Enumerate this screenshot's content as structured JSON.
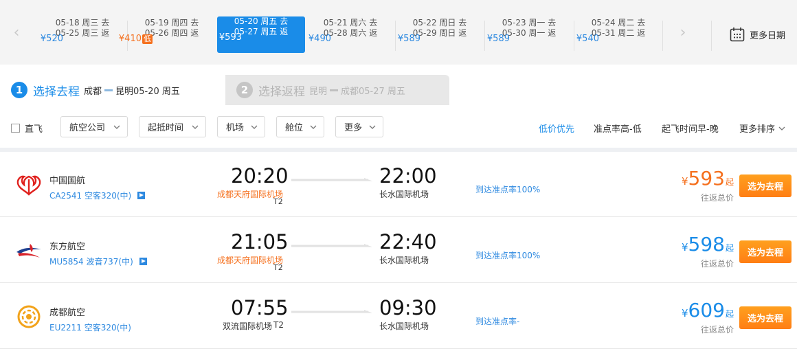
{
  "date_strip": {
    "cells": [
      {
        "go": "05-18  周三 去",
        "ret": "05-25  周三 返",
        "price": "¥520"
      },
      {
        "go": "05-19  周四 去",
        "ret": "05-26  周四 返",
        "price": "¥410",
        "tag": "低"
      },
      {
        "go": "05-20  周五 去",
        "ret": "05-27  周五 返",
        "price": "¥593"
      },
      {
        "go": "05-21  周六 去",
        "ret": "05-28  周六 返",
        "price": "¥490"
      },
      {
        "go": "05-22  周日 去",
        "ret": "05-29  周日 返",
        "price": "¥589"
      },
      {
        "go": "05-23  周一 去",
        "ret": "05-30  周一 返",
        "price": "¥589"
      },
      {
        "go": "05-24  周二 去",
        "ret": "05-31  周二 返",
        "price": "¥540"
      }
    ],
    "prev_arrow": "‹",
    "next_arrow": "›",
    "more_dates": "更多日期"
  },
  "tabs": {
    "outbound": {
      "num": "1",
      "title": "选择去程",
      "from": "成都",
      "to": "昆明05-20 周五"
    },
    "return": {
      "num": "2",
      "title": "选择返程",
      "from": "昆明",
      "to": "成都05-27 周五"
    }
  },
  "filters": {
    "direct": "直飞",
    "dropdowns": [
      "航空公司",
      "起抵时间",
      "机场",
      "舱位",
      "更多"
    ],
    "sorts": [
      "低价优先",
      "准点率高-低",
      "起飞时间早-晚",
      "更多排序"
    ]
  },
  "flights": [
    {
      "airline": "中国国航",
      "flight_no": "CA2541 空客320(中)",
      "dep_time": "20:20",
      "dep_airport": "成都天府国际机场",
      "dep_terminal": "T2",
      "arr_time": "22:00",
      "arr_airport": "长水国际机场",
      "ontime": "到达准点率100%",
      "currency": "¥",
      "price": "593",
      "qi": "起",
      "price_note": "往返总价",
      "button": "选为去程"
    },
    {
      "airline": "东方航空",
      "flight_no": "MU5854 波音737(中)",
      "dep_time": "21:05",
      "dep_airport": "成都天府国际机场",
      "dep_terminal": "T2",
      "arr_time": "22:40",
      "arr_airport": "长水国际机场",
      "ontime": "到达准点率100%",
      "currency": "¥",
      "price": "598",
      "qi": "起",
      "price_note": "往返总价",
      "button": "选为去程"
    },
    {
      "airline": "成都航空",
      "flight_no": "EU2211 空客320(中)",
      "dep_time": "07:55",
      "dep_airport": "双流国际机场",
      "dep_terminal": "T2",
      "arr_time": "09:30",
      "arr_airport": "长水国际机场",
      "ontime": "到达准点率-",
      "currency": "¥",
      "price": "609",
      "qi": "起",
      "price_note": "往返总价",
      "button": "选为去程"
    }
  ],
  "colors": {
    "accent": "#1a8ce8",
    "price_blue": "#2d89e0",
    "orange": "#f5701e",
    "button": "#ff8d1a"
  }
}
